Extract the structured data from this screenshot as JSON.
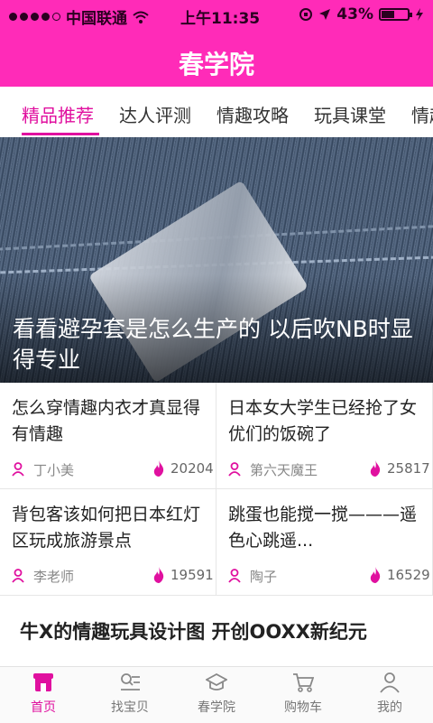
{
  "status": {
    "carrier": "中国联通",
    "time": "上午11:35",
    "battery": "43%"
  },
  "nav": {
    "title": "春学院"
  },
  "tabs": [
    {
      "label": "精品推荐",
      "active": true
    },
    {
      "label": "达人评测"
    },
    {
      "label": "情趣攻略"
    },
    {
      "label": "玩具课堂"
    },
    {
      "label": "情趣"
    }
  ],
  "hero": {
    "caption": "看看避孕套是怎么生产的 以后吹NB时显得专业"
  },
  "articles": [
    {
      "title": "怎么穿情趣内衣才真显得有情趣",
      "author": "丁小美",
      "hot": "20204"
    },
    {
      "title": "日本女大学生已经抢了女优们的饭碗了",
      "author": "第六天魔王",
      "hot": "25817"
    },
    {
      "title": "背包客该如何把日本红灯区玩成旅游景点",
      "author": "李老师",
      "hot": "19591"
    },
    {
      "title": "跳蛋也能搅一搅———遥色心跳遥...",
      "author": "陶子",
      "hot": "16529"
    }
  ],
  "next_article": {
    "title": "牛X的情趣玩具设计图 开创OOXX新纪元"
  },
  "tabbar": [
    {
      "label": "首页",
      "icon": "home-store-icon",
      "active": true
    },
    {
      "label": "找宝贝",
      "icon": "search-list-icon"
    },
    {
      "label": "春学院",
      "icon": "graduation-cap-icon"
    },
    {
      "label": "购物车",
      "icon": "cart-icon"
    },
    {
      "label": "我的",
      "icon": "user-icon"
    }
  ],
  "colors": {
    "brand": "#ff2bb8",
    "accent": "#e0109f"
  }
}
